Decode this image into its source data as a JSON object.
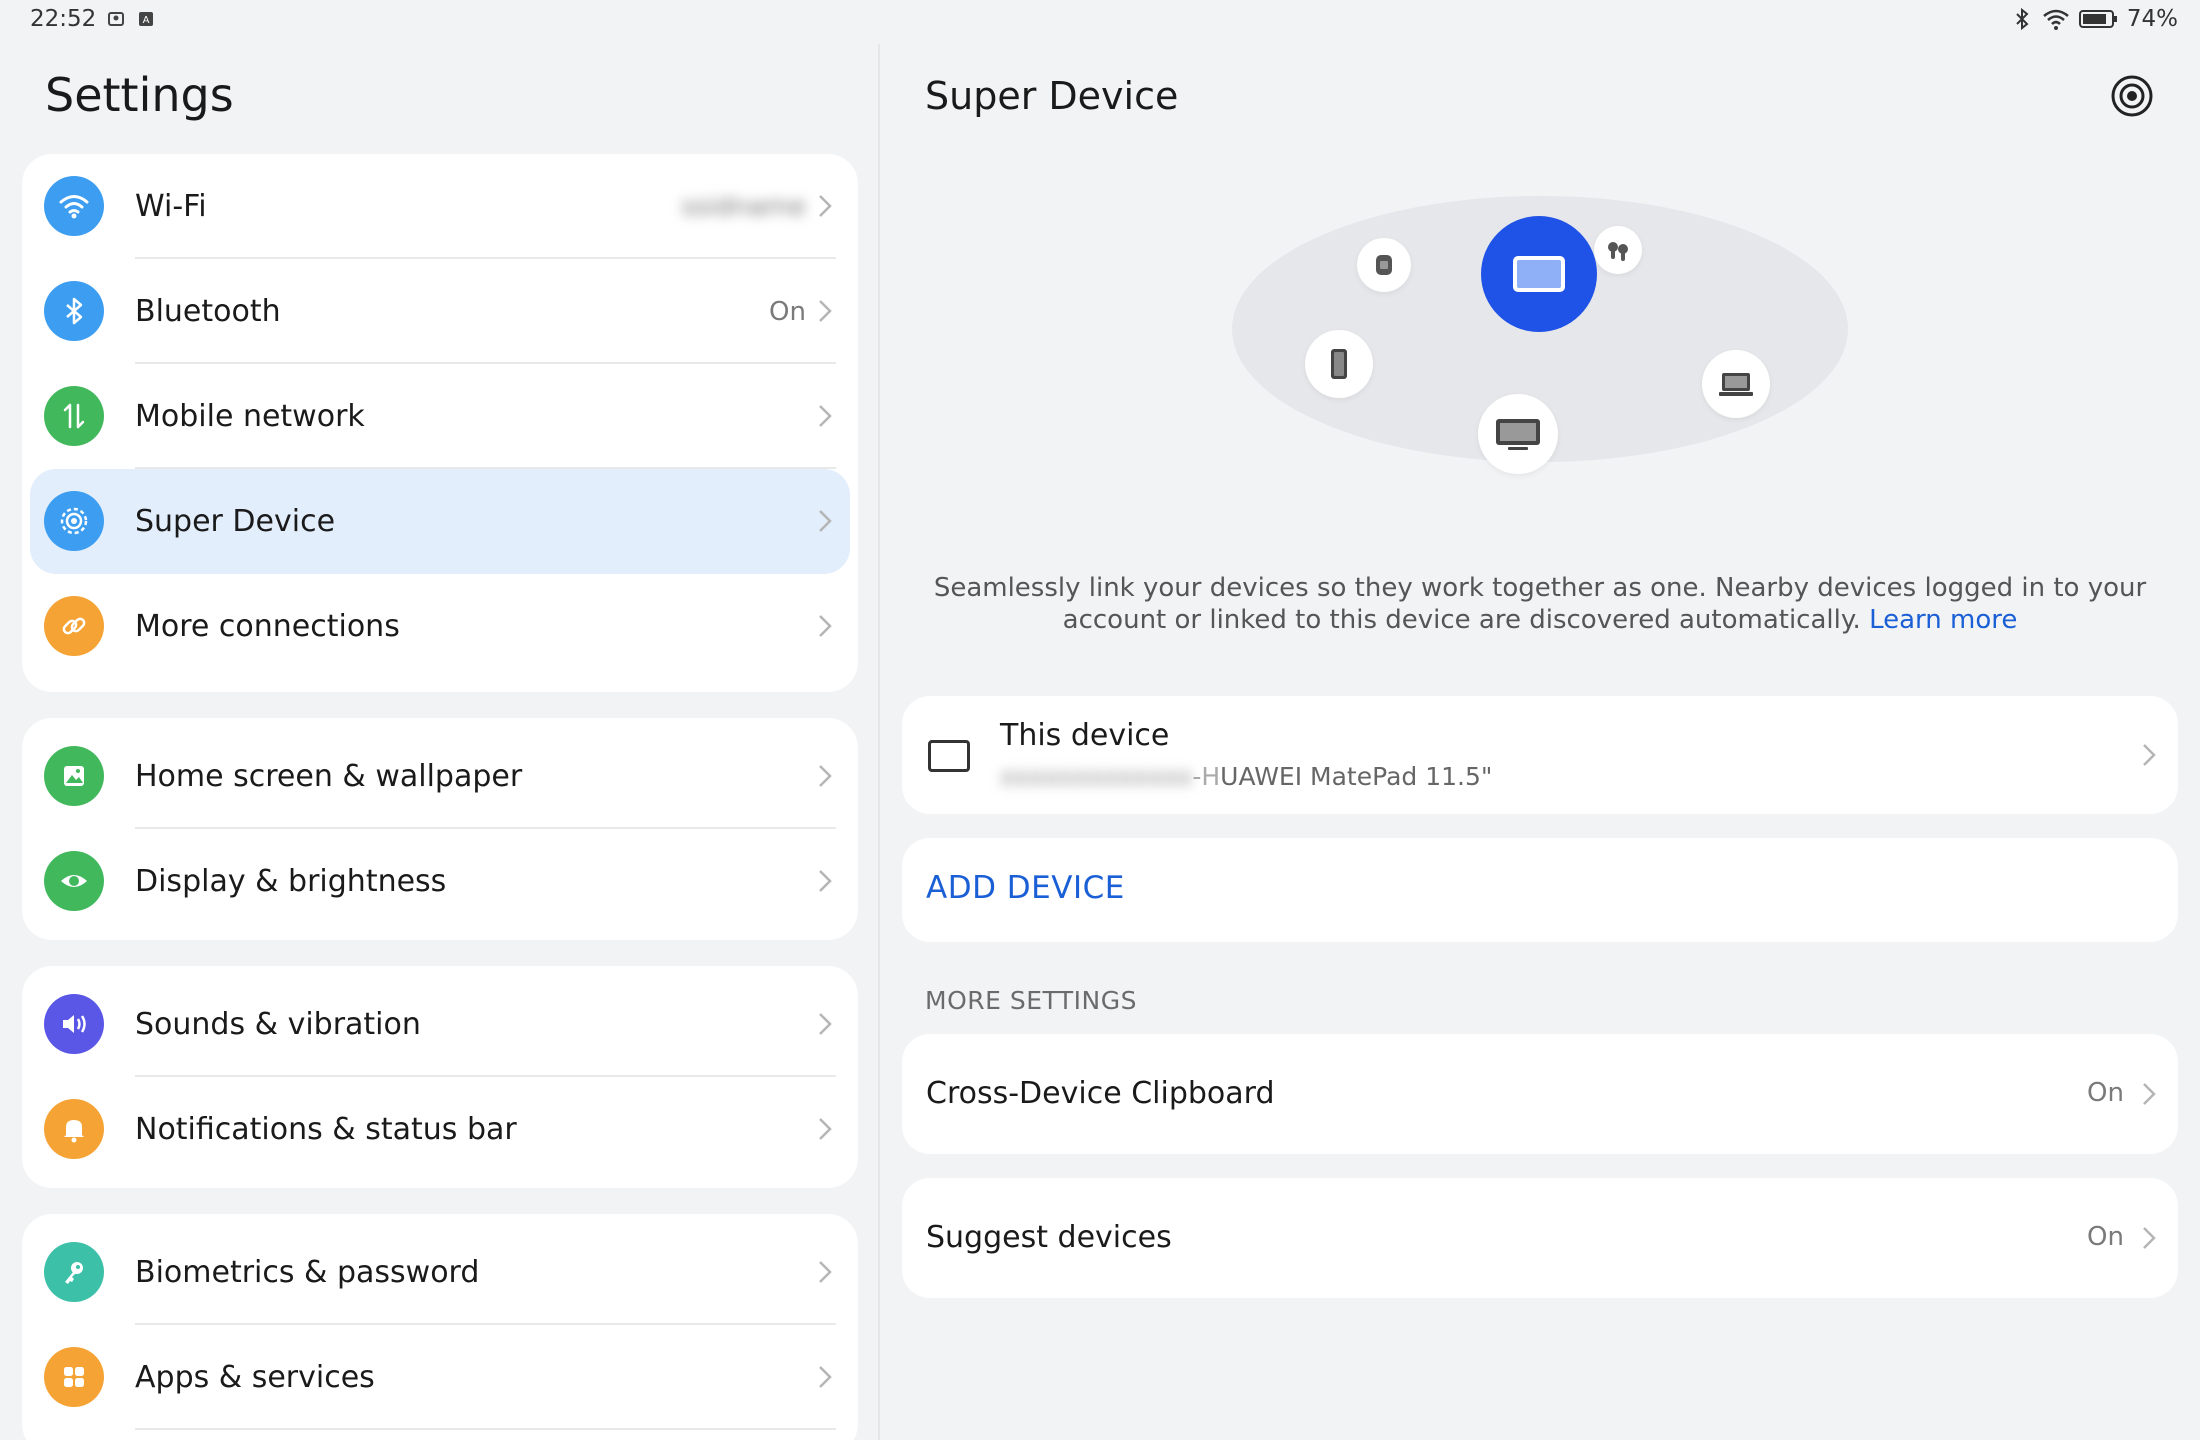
{
  "status_bar": {
    "time": "22:52",
    "battery": "74%"
  },
  "left": {
    "title": "Settings",
    "groups": [
      {
        "items": [
          {
            "label": "Wi-Fi",
            "value": "ssidname",
            "icon": "wifi-icon",
            "color": "#3d9ef1"
          },
          {
            "label": "Bluetooth",
            "value": "On",
            "icon": "bluetooth-icon",
            "color": "#3d9ef1"
          },
          {
            "label": "Mobile network",
            "value": "",
            "icon": "mobile-network-icon",
            "color": "#42b85d"
          },
          {
            "label": "Super Device",
            "value": "",
            "icon": "super-device-icon",
            "color": "#3d9ef1"
          },
          {
            "label": "More connections",
            "value": "",
            "icon": "link-icon",
            "color": "#f5a334"
          }
        ]
      },
      {
        "items": [
          {
            "label": "Home screen & wallpaper",
            "icon": "wallpaper-icon",
            "color": "#42b85d"
          },
          {
            "label": "Display & brightness",
            "icon": "eye-icon",
            "color": "#42b85d"
          }
        ]
      },
      {
        "items": [
          {
            "label": "Sounds & vibration",
            "icon": "speaker-icon",
            "color": "#5b57e6"
          },
          {
            "label": "Notifications & status bar",
            "icon": "bell-icon",
            "color": "#f5a334"
          }
        ]
      },
      {
        "items": [
          {
            "label": "Biometrics & password",
            "icon": "key-icon",
            "color": "#3dc0a8"
          },
          {
            "label": "Apps & services",
            "icon": "apps-icon",
            "color": "#f5a334"
          }
        ]
      }
    ]
  },
  "right": {
    "title": "Super Device",
    "description": "Seamlessly link your devices so they work together as one. Nearby devices logged in to your account or linked to this device are discovered automatically.",
    "learn_more": "Learn more",
    "this_device": {
      "title": "This device",
      "subtitle_hidden": "xxxxxxxxxxxxx",
      "subtitle_fragment": "-H",
      "subtitle_model": "UAWEI MatePad 11.5\""
    },
    "add_device": "ADD DEVICE",
    "more_settings_header": "MORE SETTINGS",
    "options": [
      {
        "label": "Cross-Device Clipboard",
        "value": "On"
      },
      {
        "label": "Suggest devices",
        "value": "On"
      }
    ],
    "accent": "#1f52e6"
  }
}
